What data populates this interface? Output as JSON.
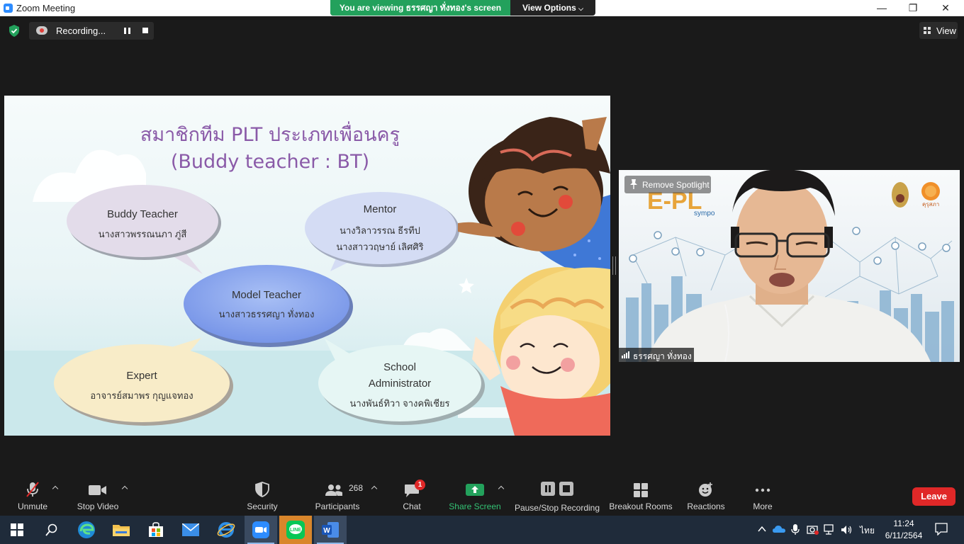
{
  "window": {
    "title": "Zoom Meeting",
    "controls": [
      "—",
      "❐",
      "✕"
    ]
  },
  "banner": {
    "viewing": "You are viewing ธรรศญา ทั่งทอง's screen",
    "view_options": "View Options"
  },
  "recording": {
    "label": "Recording..."
  },
  "view_button": {
    "label": "View"
  },
  "slide": {
    "title_line1": "สมาชิกทีม PLT ประเภทเพื่อนครู",
    "title_line2": "(Buddy teacher : BT)",
    "bubbles": {
      "buddy": {
        "role": "Buddy Teacher",
        "names": [
          "นางสาวพรรณนภา  ภู่สี"
        ]
      },
      "mentor": {
        "role": "Mentor",
        "names": [
          "นางวิลาวรรณ  ธีรทีป",
          "นางสาววฤษาย์  เลิศศิริ"
        ]
      },
      "model": {
        "role": "Model Teacher",
        "names": [
          "นางสาวธรรศญา  ทั่งทอง"
        ]
      },
      "expert": {
        "role": "Expert",
        "names": [
          "อาจารย์สมาพร  กุญแจทอง"
        ]
      },
      "admin": {
        "role_line1": "School",
        "role_line2": "Administrator",
        "names": [
          "นางพันธ์ทิวา จางคพิเชียร"
        ]
      }
    },
    "colors": {
      "buddy": "#e3dcea",
      "mentor": "#d4dcf4",
      "model": "#8aa6ee",
      "expert": "#f8ecc8",
      "admin": "#e6f6f4"
    }
  },
  "video": {
    "remove_spotlight": "Remove Spotlight",
    "participant_name": "ธรรศญา ทั่งทอง",
    "bg_logo_text": "E-PL",
    "bg_logo_sub": "sympo",
    "org_text": "คุรุสภา"
  },
  "toolbar": {
    "unmute": "Unmute",
    "stop_video": "Stop Video",
    "security": "Security",
    "participants": "Participants",
    "participants_count": "268",
    "chat": "Chat",
    "chat_badge": "1",
    "share_screen": "Share Screen",
    "pause_stop_recording": "Pause/Stop Recording",
    "breakout_rooms": "Breakout Rooms",
    "reactions": "Reactions",
    "more": "More",
    "leave": "Leave"
  },
  "taskbar": {
    "line_label": "LINE",
    "word_label": "W",
    "lang": "ไทย",
    "time": "11:24",
    "date": "6/11/2564"
  },
  "accent": {
    "zoom_blue": "#2d8cff",
    "share_green": "#23a15c",
    "leave_red": "#e02828"
  }
}
